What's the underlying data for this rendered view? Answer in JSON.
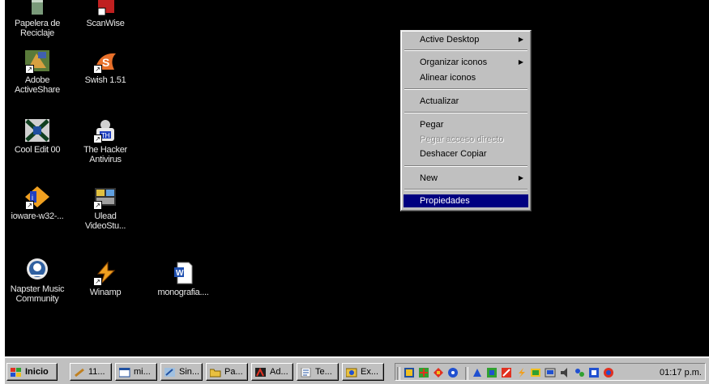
{
  "desktop": {
    "background": "#000000",
    "icons": [
      {
        "label": "Papelera de Reciclaje",
        "icon": "recycle-bin-icon"
      },
      {
        "label": "ScanWise",
        "icon": "scanwise-icon"
      },
      {
        "label": "Adobe ActiveShare",
        "icon": "adobe-activeshare-icon"
      },
      {
        "label": "Swish 1.51",
        "icon": "swish-icon"
      },
      {
        "label": "Cool Edit 00",
        "icon": "cool-edit-icon"
      },
      {
        "label": "The Hacker Antivirus",
        "icon": "antivirus-icon"
      },
      {
        "label": "ioware-w32-...",
        "icon": "ioware-icon"
      },
      {
        "label": "Ulead VideoStu...",
        "icon": "ulead-video-icon"
      },
      {
        "label": "Napster Music Community",
        "icon": "napster-icon"
      },
      {
        "label": "Winamp",
        "icon": "winamp-icon"
      },
      {
        "label": "monografia....",
        "icon": "word-document-icon"
      }
    ]
  },
  "context_menu": {
    "items": [
      {
        "label": "Active Desktop",
        "submenu": true
      },
      {
        "label": "Organizar iconos",
        "submenu": true
      },
      {
        "label": "Alinear iconos",
        "submenu": false
      },
      {
        "label": "Actualizar",
        "submenu": false
      },
      {
        "label": "Pegar",
        "submenu": false
      },
      {
        "label": "Pegar acceso directo",
        "submenu": false,
        "disabled": true
      },
      {
        "label": "Deshacer Copiar",
        "submenu": false
      },
      {
        "label": "New",
        "submenu": true
      },
      {
        "label": "Propiedades",
        "submenu": false,
        "highlighted": true
      }
    ],
    "highlight_color": "#000080"
  },
  "taskbar": {
    "start_label": "Inicio",
    "buttons": [
      {
        "label": "11...",
        "icon": "app-icon"
      },
      {
        "label": "mi...",
        "icon": "window-icon"
      },
      {
        "label": "Sin...",
        "icon": "paint-icon"
      },
      {
        "label": "Pa...",
        "icon": "folder-icon"
      },
      {
        "label": "Ad...",
        "icon": "adobe-icon"
      },
      {
        "label": "Te...",
        "icon": "text-icon"
      },
      {
        "label": "Ex...",
        "icon": "explorer-icon"
      }
    ],
    "clock": "01:17 p.m."
  }
}
